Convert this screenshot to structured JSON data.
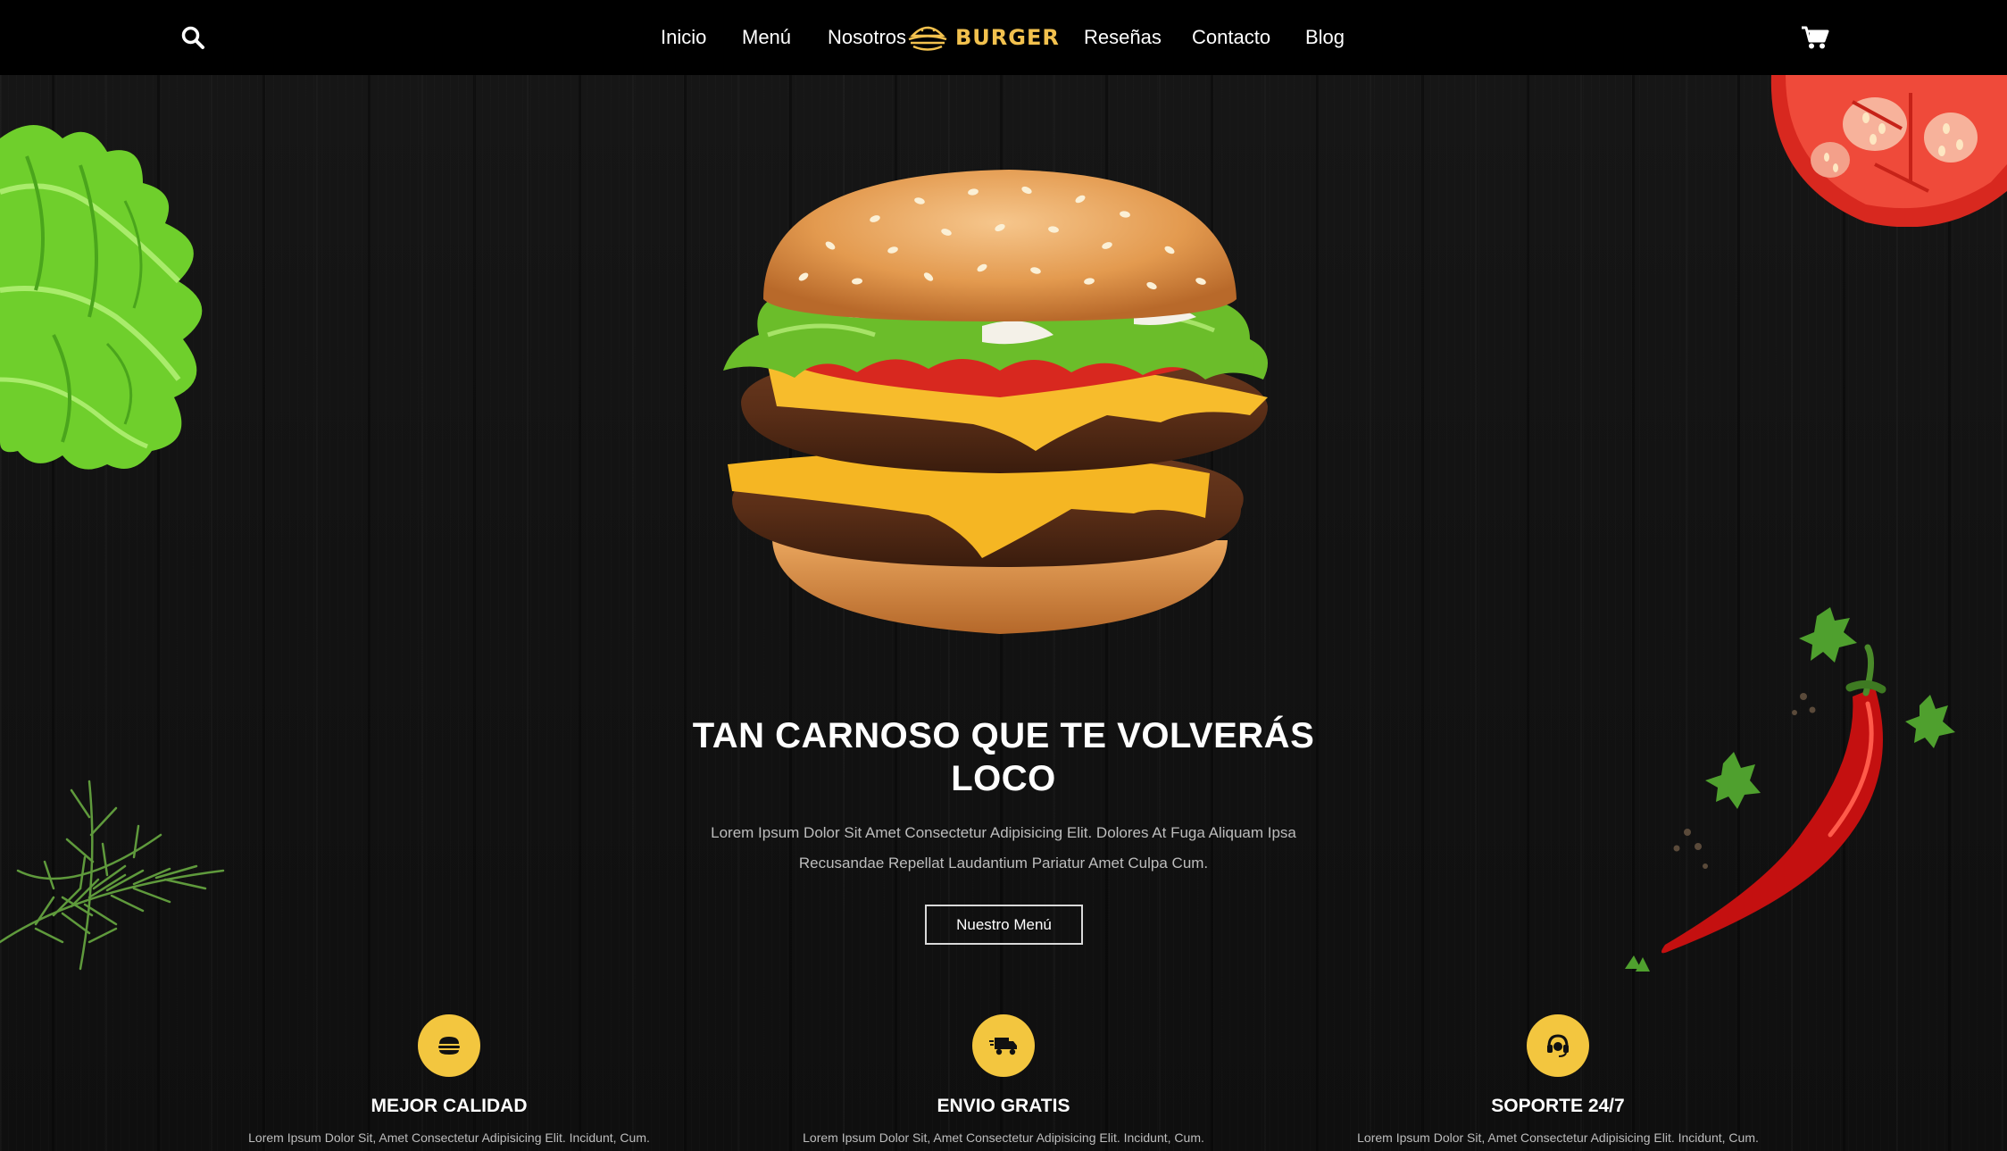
{
  "nav": {
    "links_left": [
      "Inicio",
      "Menú",
      "Nosotros"
    ],
    "links_right": [
      "Reseñas",
      "Contacto",
      "Blog"
    ],
    "logo_text": "BURGER",
    "search_icon": "search-icon",
    "cart_icon": "cart-icon"
  },
  "hero": {
    "title": "TAN CARNOSO QUE TE VOLVERÁS LOCO",
    "text": "Lorem Ipsum Dolor Sit Amet Consectetur Adipisicing Elit. Dolores At Fuga Aliquam Ipsa Recusandae Repellat Laudantium Pariatur Amet Culpa Cum.",
    "button_label": "Nuestro Menú"
  },
  "features": [
    {
      "icon": "burger-icon",
      "title": "MEJOR CALIDAD",
      "text": "Lorem Ipsum Dolor Sit, Amet Consectetur Adipisicing Elit. Incidunt, Cum."
    },
    {
      "icon": "truck-icon",
      "title": "ENVIO GRATIS",
      "text": "Lorem Ipsum Dolor Sit, Amet Consectetur Adipisicing Elit. Incidunt, Cum."
    },
    {
      "icon": "headset-icon",
      "title": "SOPORTE 24/7",
      "text": "Lorem Ipsum Dolor Sit, Amet Consectetur Adipisicing Elit. Incidunt, Cum."
    }
  ],
  "colors": {
    "accent": "#f3c63f",
    "logo": "#f2c14e",
    "background": "#121212"
  }
}
